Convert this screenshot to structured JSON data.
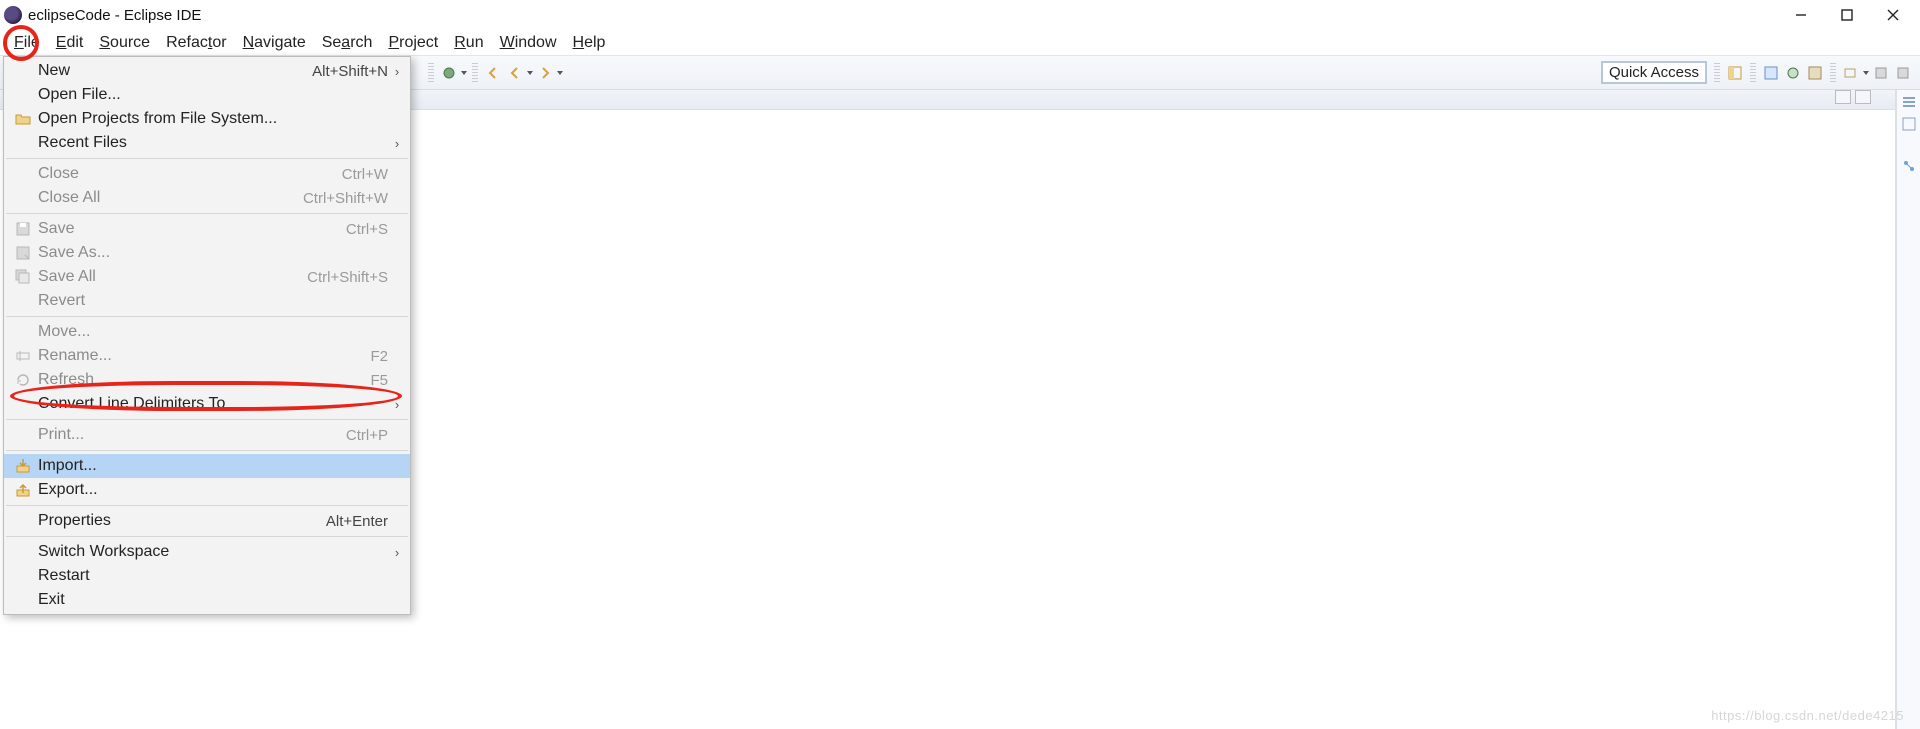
{
  "title": "eclipseCode - Eclipse IDE",
  "window_buttons": {
    "minimize": "minimize",
    "maximize": "maximize",
    "close": "close"
  },
  "menubar": [
    "File",
    "Edit",
    "Source",
    "Refactor",
    "Navigate",
    "Search",
    "Project",
    "Run",
    "Window",
    "Help"
  ],
  "toolbar": {
    "quick_access": "Quick Access"
  },
  "file_menu": {
    "groups": [
      [
        {
          "label": "New",
          "accel": "Alt+Shift+N",
          "submenu": true,
          "icon": "",
          "disabled": false
        },
        {
          "label": "Open File...",
          "accel": "",
          "submenu": false,
          "icon": "",
          "disabled": false
        },
        {
          "label": "Open Projects from File System...",
          "accel": "",
          "submenu": false,
          "icon": "folder-open",
          "disabled": false
        },
        {
          "label": "Recent Files",
          "accel": "",
          "submenu": true,
          "icon": "",
          "disabled": false
        }
      ],
      [
        {
          "label": "Close",
          "accel": "Ctrl+W",
          "submenu": false,
          "icon": "",
          "disabled": true
        },
        {
          "label": "Close All",
          "accel": "Ctrl+Shift+W",
          "submenu": false,
          "icon": "",
          "disabled": true
        }
      ],
      [
        {
          "label": "Save",
          "accel": "Ctrl+S",
          "submenu": false,
          "icon": "save",
          "disabled": true
        },
        {
          "label": "Save As...",
          "accel": "",
          "submenu": false,
          "icon": "save-as",
          "disabled": true
        },
        {
          "label": "Save All",
          "accel": "Ctrl+Shift+S",
          "submenu": false,
          "icon": "save-all",
          "disabled": true
        },
        {
          "label": "Revert",
          "accel": "",
          "submenu": false,
          "icon": "",
          "disabled": true
        }
      ],
      [
        {
          "label": "Move...",
          "accel": "",
          "submenu": false,
          "icon": "",
          "disabled": true
        },
        {
          "label": "Rename...",
          "accel": "F2",
          "submenu": false,
          "icon": "rename",
          "disabled": true
        },
        {
          "label": "Refresh",
          "accel": "F5",
          "submenu": false,
          "icon": "refresh",
          "disabled": true
        },
        {
          "label": "Convert Line Delimiters To",
          "accel": "",
          "submenu": true,
          "icon": "",
          "disabled": false
        }
      ],
      [
        {
          "label": "Print...",
          "accel": "Ctrl+P",
          "submenu": false,
          "icon": "",
          "disabled": true
        }
      ],
      [
        {
          "label": "Import...",
          "accel": "",
          "submenu": false,
          "icon": "import",
          "disabled": false,
          "selected": true
        },
        {
          "label": "Export...",
          "accel": "",
          "submenu": false,
          "icon": "export",
          "disabled": false
        }
      ],
      [
        {
          "label": "Properties",
          "accel": "Alt+Enter",
          "submenu": false,
          "icon": "",
          "disabled": false
        }
      ],
      [
        {
          "label": "Switch Workspace",
          "accel": "",
          "submenu": true,
          "icon": "",
          "disabled": false
        },
        {
          "label": "Restart",
          "accel": "",
          "submenu": false,
          "icon": "",
          "disabled": false
        },
        {
          "label": "Exit",
          "accel": "",
          "submenu": false,
          "icon": "",
          "disabled": false
        }
      ]
    ]
  },
  "watermark": "https://blog.csdn.net/dede4215"
}
